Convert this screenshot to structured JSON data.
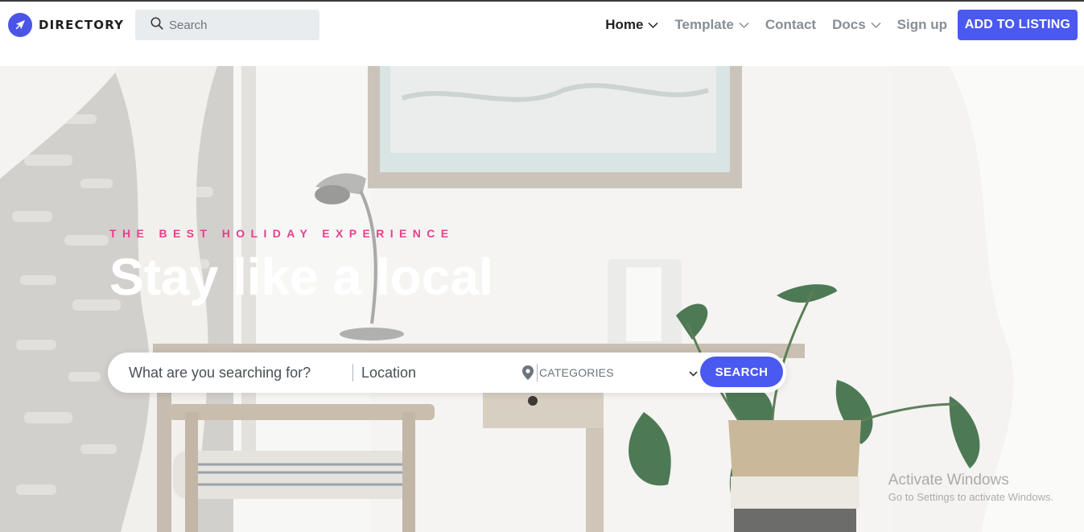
{
  "brand": {
    "name": "DIRECTORY",
    "logo_icon": "rocket-icon"
  },
  "nav_search": {
    "placeholder": "Search",
    "icon": "search-icon"
  },
  "nav": {
    "items": [
      {
        "label": "Home",
        "active": true,
        "has_dropdown": true
      },
      {
        "label": "Template",
        "active": false,
        "has_dropdown": true
      },
      {
        "label": "Contact",
        "active": false,
        "has_dropdown": false
      },
      {
        "label": "Docs",
        "active": false,
        "has_dropdown": true
      },
      {
        "label": "Sign up",
        "active": false,
        "has_dropdown": false
      }
    ],
    "cta_label": "ADD TO LISTING"
  },
  "hero": {
    "kicker": "THE BEST HOLIDAY EXPERIENCE",
    "title": "Stay like a local"
  },
  "searchbar": {
    "what_placeholder": "What are you searching for?",
    "location_placeholder": "Location",
    "location_icon": "map-pin-icon",
    "category_selected": "CATEGORIES",
    "button_label": "SEARCH"
  },
  "watermark": {
    "title": "Activate Windows",
    "subtitle": "Go to Settings to activate Windows."
  },
  "colors": {
    "accent": "#4a59f0",
    "kicker": "#e83e8c",
    "nav_active": "#222222",
    "nav_inactive": "#868e96"
  }
}
